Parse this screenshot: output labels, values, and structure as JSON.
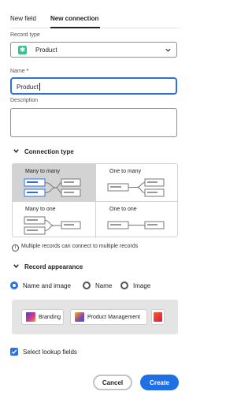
{
  "tabs": [
    {
      "label": "New field",
      "selected": false
    },
    {
      "label": "New connection",
      "selected": true
    }
  ],
  "record_type": {
    "label": "Record type",
    "value": "Product",
    "icon": "asterisk-icon",
    "icon_color": "#34c48b"
  },
  "name": {
    "label": "Name",
    "required_mark": "*",
    "value": "Product"
  },
  "description": {
    "label": "Description",
    "value": ""
  },
  "connection_type": {
    "title": "Connection type",
    "options": [
      {
        "label": "Many to many",
        "selected": true
      },
      {
        "label": "One to many",
        "selected": false
      },
      {
        "label": "Many to one",
        "selected": false
      },
      {
        "label": "One to one",
        "selected": false
      }
    ],
    "info_text": "Multiple records can connect to multiple records"
  },
  "record_appearance": {
    "title": "Record appearance",
    "options": [
      {
        "label": "Name and image",
        "selected": true
      },
      {
        "label": "Name",
        "selected": false
      },
      {
        "label": "Image",
        "selected": false
      }
    ],
    "preview_chips": [
      {
        "label": "Branding"
      },
      {
        "label": "Product Management"
      },
      {
        "label": ""
      }
    ]
  },
  "lookup": {
    "label": "Select lookup fields",
    "checked": true
  },
  "actions": {
    "cancel_label": "Cancel",
    "create_label": "Create"
  },
  "colors": {
    "accent": "#2f70e0",
    "primary_button": "#1f6fe5"
  }
}
